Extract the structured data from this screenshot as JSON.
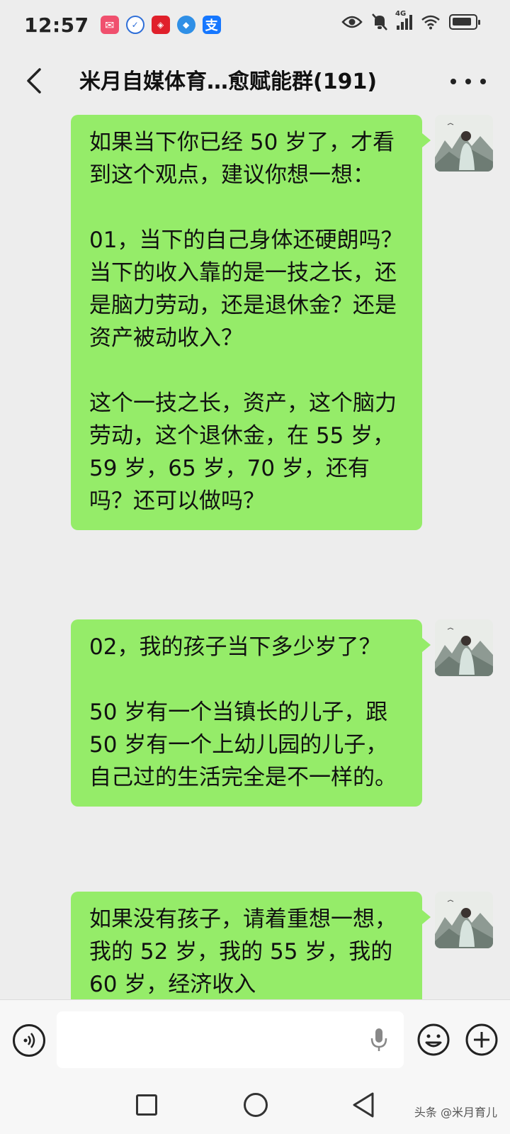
{
  "status_bar": {
    "time": "12:57",
    "network": "4G",
    "battery_level": 0.85,
    "notification_icons": [
      "mail-icon",
      "shield-check-icon",
      "app-red-icon",
      "compass-icon",
      "alipay-icon"
    ]
  },
  "header": {
    "title": "米月自媒体育…愈赋能群(191)"
  },
  "messages": [
    {
      "text": "如果当下你已经 50 岁了，才看到这个观点，建议你想一想：\n\n01，当下的自己身体还硬朗吗？当下的收入靠的是一技之长，还是脑力劳动，还是退休金？还是资产被动收入？\n\n这个一技之长，资产，这个脑力劳动，这个退休金，在 55 岁，59 岁，65 岁，70 岁，还有吗？还可以做吗？"
    },
    {
      "text": "02，我的孩子当下多少岁了？\n\n50 岁有一个当镇长的儿子，跟 50 岁有一个上幼儿园的儿子，自己过的生活完全是不一样的。"
    },
    {
      "text": "如果没有孩子，请着重想一想，我的 52 岁，我的 55 岁，我的 60 岁，经济收入"
    }
  ],
  "colors": {
    "bubble": "#95ec69",
    "background": "#ededed"
  },
  "watermark": "头条 @米月育儿"
}
